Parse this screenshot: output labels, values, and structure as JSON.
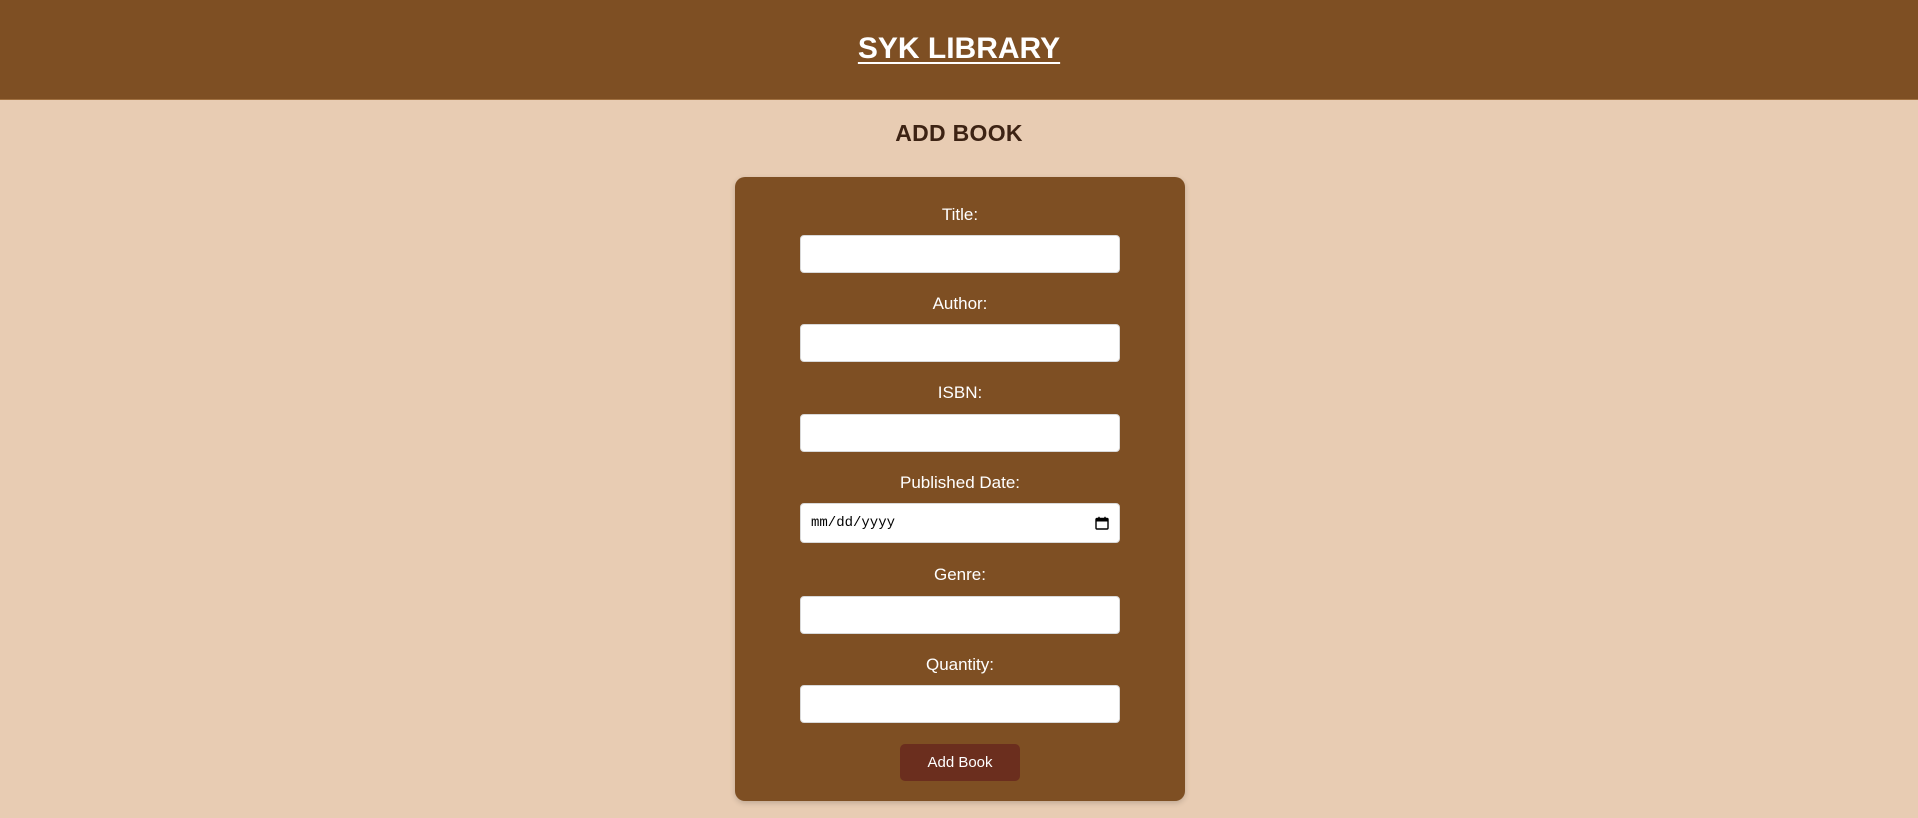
{
  "header": {
    "brand": "SYK LIBRARY"
  },
  "page": {
    "title": "ADD BOOK"
  },
  "form": {
    "fields": [
      {
        "label": "Title:",
        "value": ""
      },
      {
        "label": "Author:",
        "value": ""
      },
      {
        "label": "ISBN:",
        "value": ""
      },
      {
        "label": "Published Date:",
        "value": "",
        "placeholder": "mm/dd/yyyy"
      },
      {
        "label": "Genre:",
        "value": ""
      },
      {
        "label": "Quantity:",
        "value": ""
      }
    ],
    "submit_label": "Add Book"
  },
  "colors": {
    "background": "#e8ccb3",
    "header": "#7e4f23",
    "card": "#7e4f23",
    "button": "#6b2e1e",
    "title_text": "#3d2314"
  },
  "icons": {
    "date_picker": "calendar-icon"
  }
}
